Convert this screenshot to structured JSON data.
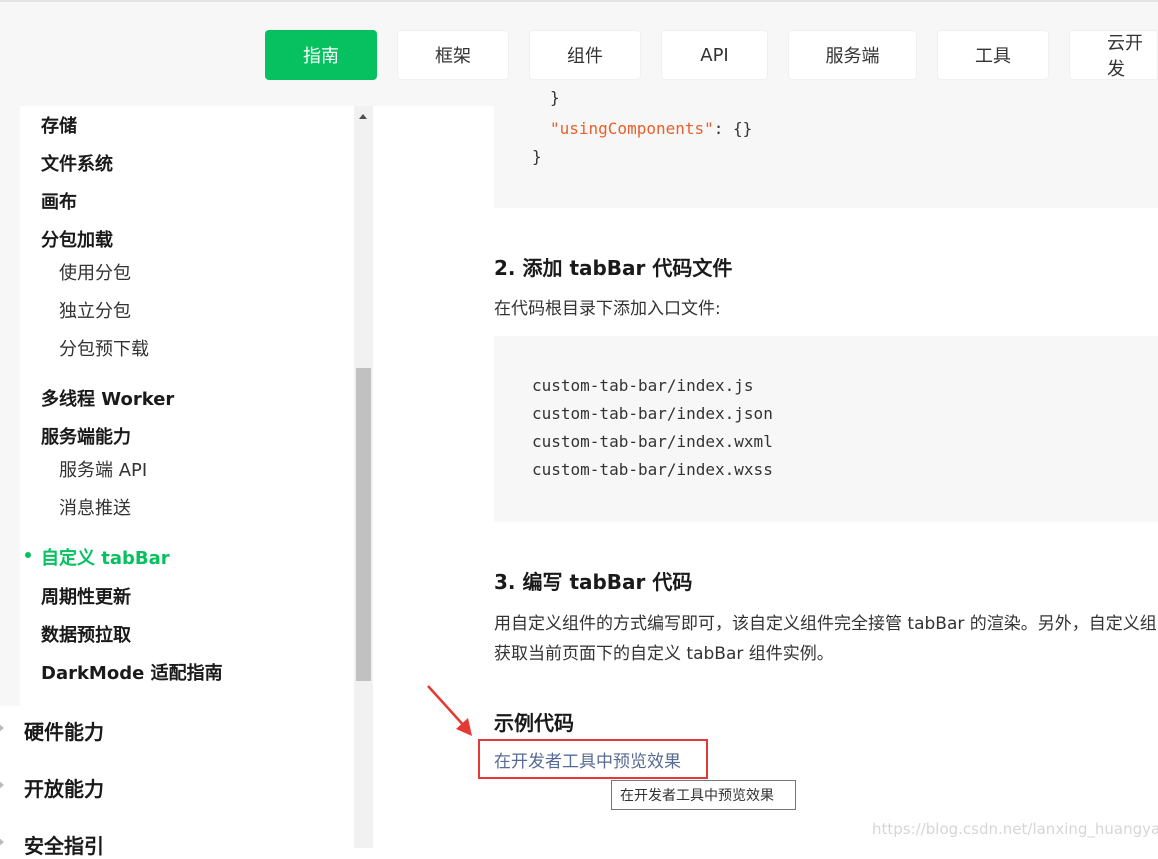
{
  "nav": {
    "tabs": [
      {
        "label": "指南",
        "active": true
      },
      {
        "label": "框架",
        "active": false
      },
      {
        "label": "组件",
        "active": false
      },
      {
        "label": "API",
        "active": false
      },
      {
        "label": "服务端",
        "active": false
      },
      {
        "label": "工具",
        "active": false
      },
      {
        "label": "云开发",
        "active": false
      }
    ]
  },
  "sidebar": {
    "items": {
      "storage": "存储",
      "filesystem": "文件系统",
      "canvas": "画布",
      "subpackages": "分包加载",
      "use_subpackages": "使用分包",
      "independent_subpackages": "独立分包",
      "subpackage_preload": "分包预下载",
      "worker": "多线程 Worker",
      "server_ability": "服务端能力",
      "server_api": "服务端 API",
      "message_push": "消息推送",
      "custom_tabbar": "自定义 tabBar",
      "periodic_update": "周期性更新",
      "prefetch": "数据预拉取",
      "darkmode": "DarkMode 适配指南"
    },
    "sections": {
      "hardware": "硬件能力",
      "open": "开放能力",
      "security": "安全指引"
    }
  },
  "content": {
    "code1": {
      "line_brace": "}",
      "using_key": "\"usingComponents\"",
      "using_rest": ": {}",
      "close": "}"
    },
    "heading2": "2. 添加 tabBar 代码文件",
    "para2": "在代码根目录下添加入口文件:",
    "files": [
      "custom-tab-bar/index.js",
      "custom-tab-bar/index.json",
      "custom-tab-bar/index.wxml",
      "custom-tab-bar/index.wxss"
    ],
    "heading3": "3. 编写 tabBar 代码",
    "para3_line1": "用自定义组件的方式编写即可，该自定义组件完全接管 tabBar 的渲染。另外，自定义组",
    "para3_line2": "获取当前页面下的自定义 tabBar 组件实例。",
    "example_heading": "示例代码",
    "preview_link": "在开发者工具中预览效果",
    "tooltip": "在开发者工具中预览效果"
  },
  "watermark": "https://blog.csdn.net/lanxing_huangyao",
  "colors": {
    "accent": "#07c160",
    "link": "#576b95",
    "highlight_box": "#e53935",
    "code_string": "#e8602c"
  }
}
